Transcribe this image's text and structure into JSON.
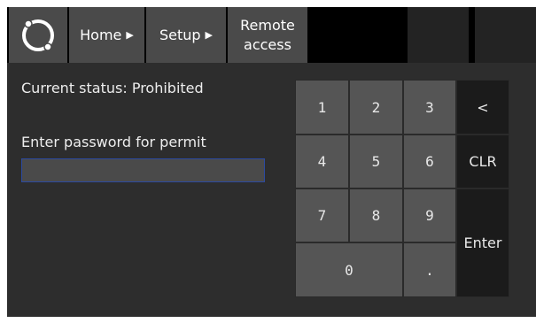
{
  "nav": {
    "home_label": "Home",
    "setup_label": "Setup",
    "remote_line1": "Remote",
    "remote_line2": "access",
    "arrow": "▶"
  },
  "status": {
    "text": "Current status: Prohibited"
  },
  "password": {
    "prompt": "Enter password for permit",
    "value": "",
    "placeholder": ""
  },
  "keypad": {
    "keys": {
      "k1": "1",
      "k2": "2",
      "k3": "3",
      "back": "<",
      "k4": "4",
      "k5": "5",
      "k6": "6",
      "clr": "CLR",
      "k7": "7",
      "k8": "8",
      "k9": "9",
      "enter": "Enter",
      "k0": "0",
      "dot": "."
    }
  },
  "icons": {
    "logo": "ring-logo-icon"
  },
  "colors": {
    "background": "#2d2d2d",
    "topbar": "#000000",
    "nav_button": "#4a4a4a",
    "numeric_key": "#555555",
    "control_key": "#1b1b1b",
    "input_border": "#2c4aa0"
  }
}
